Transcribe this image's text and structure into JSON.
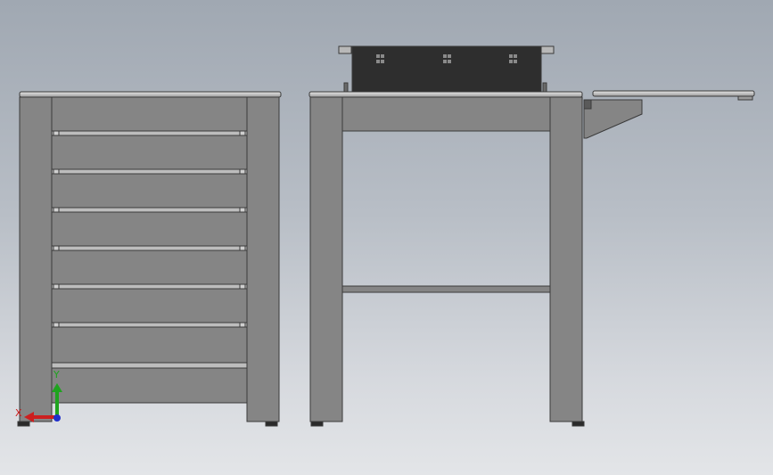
{
  "viewport": {
    "background_top": "#a0a8b2",
    "background_bottom": "#e3e5e8",
    "part_fill": "#858585",
    "part_edge": "#3a3a3a",
    "dark_part_fill": "#2e2e2e"
  },
  "triad": {
    "x_label": "X",
    "y_label": "Y",
    "x_color": "#cc1f1f",
    "y_color": "#1fa31f",
    "z_color": "#1f2fcc"
  },
  "views": {
    "left_view": "front-view",
    "right_view": "side-view"
  }
}
